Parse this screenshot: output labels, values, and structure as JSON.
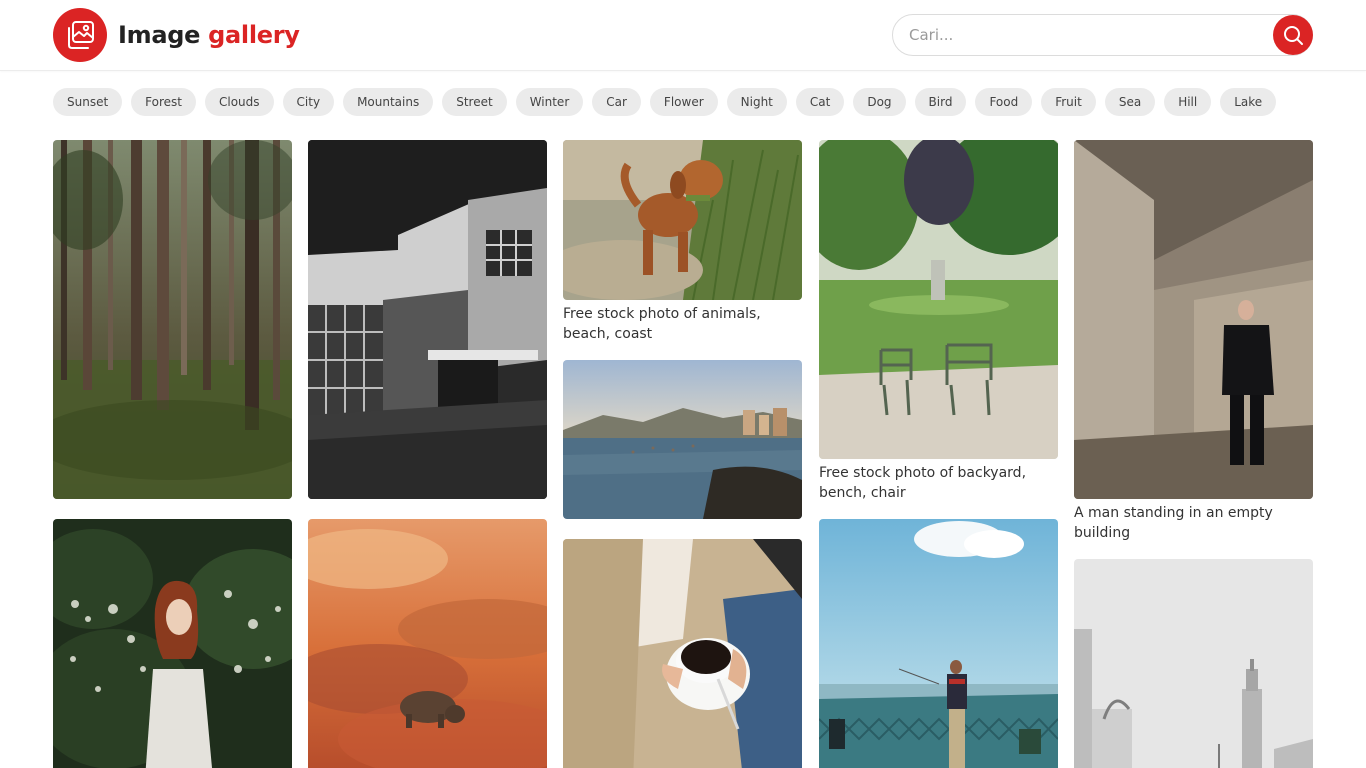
{
  "header": {
    "brand_part1": "Image",
    "brand_part2": "gallery",
    "search_placeholder": "Cari...",
    "search_value": ""
  },
  "colors": {
    "accent": "#db2424",
    "tag_bg": "#ebebeb"
  },
  "icons": {
    "logo": "gallery-icon",
    "search": "search-icon"
  },
  "tags": [
    "Sunset",
    "Forest",
    "Clouds",
    "City",
    "Mountains",
    "Street",
    "Winter",
    "Car",
    "Flower",
    "Night",
    "Cat",
    "Dog",
    "Bird",
    "Food",
    "Fruit",
    "Sea",
    "Hill",
    "Lake"
  ],
  "gallery": {
    "captions": {
      "dog": "Free stock photo of animals, beach, coast",
      "park": "Free stock photo of backyard, bench, chair",
      "man": "A man standing in an empty building"
    }
  }
}
